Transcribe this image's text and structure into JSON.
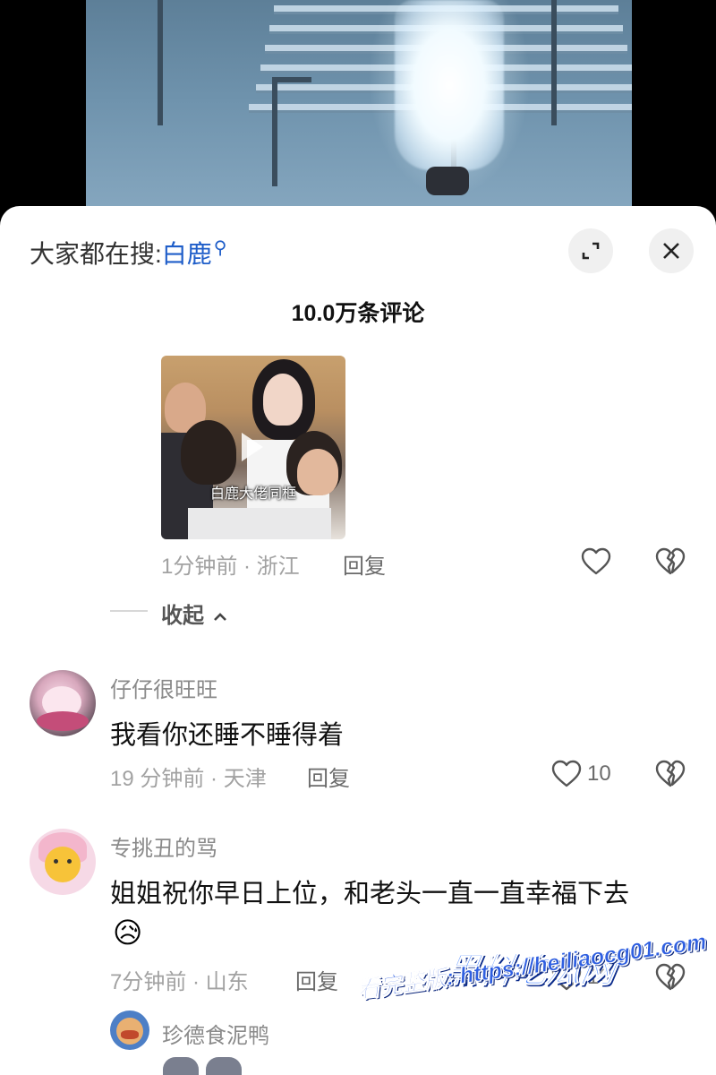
{
  "search_bar": {
    "prefix": "大家都在搜:",
    "keyword": "白鹿",
    "search_icon": "search-icon"
  },
  "controls": {
    "expand_icon": "expand-icon",
    "close_icon": "close-icon"
  },
  "comment_count": "10.0万条评论",
  "reply_media": {
    "caption": "白鹿大佬同框"
  },
  "reply_meta": {
    "time_location": "1分钟前 · 浙江",
    "reply_label": "回复"
  },
  "collapse_label": "收起",
  "comments": [
    {
      "username": "仔仔很旺旺",
      "text": "我看你还睡不睡得着",
      "time_location": "19 分钟前 · 天津",
      "reply_label": "回复",
      "likes": "10"
    },
    {
      "username": "专挑丑的骂",
      "text": "姐姐祝你早日上位，和老头一直一直幸福下去",
      "emoji": "😥",
      "time_location": "7分钟前 · 山东",
      "reply_label": "回复",
      "likes": "18"
    }
  ],
  "sub_reply": {
    "username": "珍德食泥鸭"
  },
  "watermark": {
    "brand": "黑料吃瓜网",
    "url": "看完整版: https://heiliaocg01.com"
  },
  "colors": {
    "keyword": "#1f5ec9",
    "meta_gray": "#a2a2a2",
    "text": "#111111"
  }
}
